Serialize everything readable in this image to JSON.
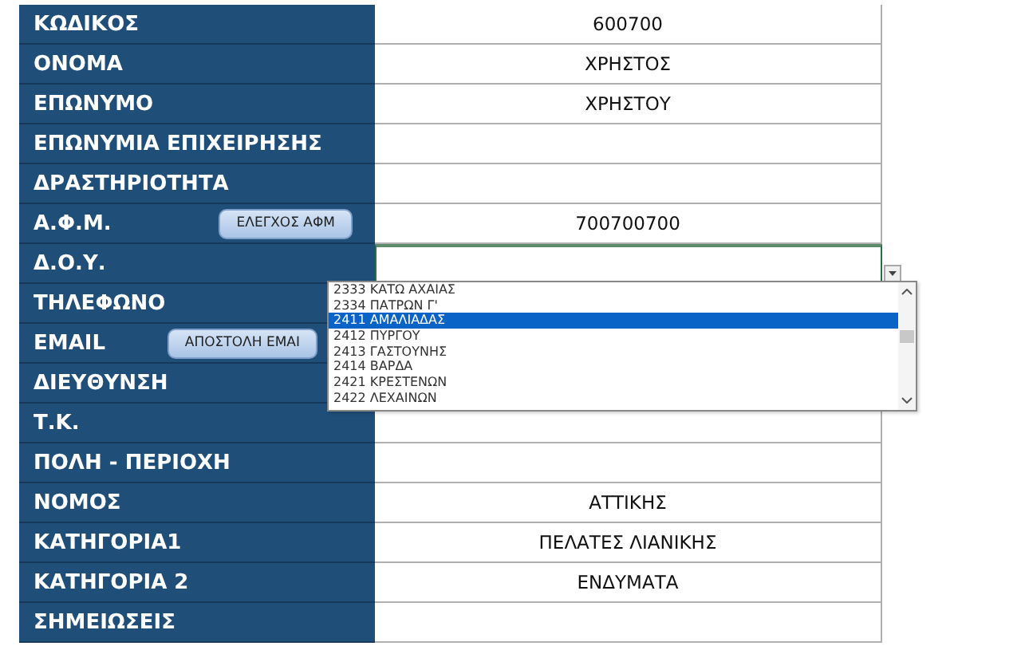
{
  "fields": [
    {
      "label": "ΚΩΔΙΚΟΣ",
      "value": "600700"
    },
    {
      "label": "ΟΝΟΜΑ",
      "value": "ΧΡΗΣΤΟΣ"
    },
    {
      "label": "ΕΠΩΝΥΜΟ",
      "value": "ΧΡΗΣΤΟΥ"
    },
    {
      "label": "ΕΠΩΝΥΜΙΑ ΕΠΙΧΕΙΡΗΣΗΣ"
    },
    {
      "label": "ΔΡΑΣΤΗΡΙΟΤΗΤΑ"
    },
    {
      "label": "Α.Φ.Μ.",
      "value": "700700700",
      "button": "ΕΛΕΓΧΟΣ ΑΦΜ"
    },
    {
      "label": "Δ.Ο.Υ.",
      "dropdown": true
    },
    {
      "label": "ΤΗΛΕΦΩΝΟ"
    },
    {
      "label": "EMAIL",
      "button": "ΑΠΟΣΤΟΛΗ EMAI"
    },
    {
      "label": "ΔΙΕΥΘΥΝΣΗ"
    },
    {
      "label": "Τ.Κ."
    },
    {
      "label": "ΠΟΛΗ - ΠΕΡΙΟΧΗ"
    },
    {
      "label": "ΝΟΜΟΣ",
      "value": "ΑΤΤΙΚΗΣ"
    },
    {
      "label": "ΚΑΤΗΓΟΡΙΑ1",
      "value": "ΠΕΛΑΤΕΣ ΛΙΑΝΙΚΗΣ"
    },
    {
      "label": "ΚΑΤΗΓΟΡΙΑ 2",
      "value": "ΕΝΔΥΜΑΤΑ"
    },
    {
      "label": "ΣΗΜΕΙΩΣΕΙΣ"
    }
  ],
  "dropdown_list": [
    {
      "text": "2333 ΚΑΤΩ ΑΧΑΙΑΣ",
      "selected": false
    },
    {
      "text": "2334 ΠΑΤΡΩΝ Γ'",
      "selected": false
    },
    {
      "text": "2411 ΑΜΑΛΙΑΔΑΣ",
      "selected": true
    },
    {
      "text": "2412 ΠΥΡΓΟΥ",
      "selected": false
    },
    {
      "text": "2413 ΓΑΣΤΟΥΝΗΣ",
      "selected": false
    },
    {
      "text": "2414 ΒΑΡΔΑ",
      "selected": false
    },
    {
      "text": "2421 ΚΡΕΣΤΕΝΩΝ",
      "selected": false
    },
    {
      "text": "2422 ΛΕΧΑΙΝΩΝ",
      "selected": false
    }
  ]
}
